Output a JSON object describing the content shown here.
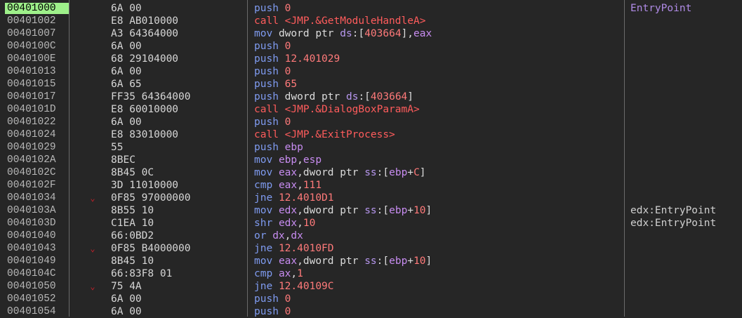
{
  "colors": {
    "background": "#262626",
    "current_address_bg": "#9ef08a",
    "mnemonic": "#7f9bf0",
    "call": "#ff5c5c",
    "number": "#ff7a7a",
    "register": "#c78cf0",
    "label_comment": "#b08be6",
    "jump_arrow": "#c8202a"
  },
  "rows": [
    {
      "addr": "00401000",
      "current": true,
      "arrow": "",
      "bytes": "6A 00",
      "instr": [
        [
          "mn",
          "push"
        ],
        [
          "pn",
          " "
        ],
        [
          "num",
          "0"
        ]
      ],
      "comment": "EntryPoint",
      "comment_type": "label"
    },
    {
      "addr": "00401002",
      "arrow": "",
      "bytes": "E8 AB010000",
      "instr": [
        [
          "call",
          "call"
        ],
        [
          "pn",
          " "
        ],
        [
          "sym",
          "<JMP.&GetModuleHandleA>"
        ]
      ],
      "comment": ""
    },
    {
      "addr": "00401007",
      "arrow": "",
      "bytes": "A3 64364000",
      "instr": [
        [
          "mn",
          "mov"
        ],
        [
          "pn",
          " "
        ],
        [
          "kw",
          "dword ptr"
        ],
        [
          "pn",
          " "
        ],
        [
          "seg",
          "ds"
        ],
        [
          "pn",
          ":["
        ],
        [
          "num",
          "403664"
        ],
        [
          "pn",
          "],"
        ],
        [
          "reg",
          "eax"
        ]
      ],
      "comment": ""
    },
    {
      "addr": "0040100C",
      "arrow": "",
      "bytes": "6A 00",
      "instr": [
        [
          "mn",
          "push"
        ],
        [
          "pn",
          " "
        ],
        [
          "num",
          "0"
        ]
      ],
      "comment": ""
    },
    {
      "addr": "0040100E",
      "arrow": "",
      "bytes": "68 29104000",
      "instr": [
        [
          "mn",
          "push"
        ],
        [
          "pn",
          " "
        ],
        [
          "num",
          "12.401029"
        ]
      ],
      "comment": ""
    },
    {
      "addr": "00401013",
      "arrow": "",
      "bytes": "6A 00",
      "instr": [
        [
          "mn",
          "push"
        ],
        [
          "pn",
          " "
        ],
        [
          "num",
          "0"
        ]
      ],
      "comment": ""
    },
    {
      "addr": "00401015",
      "arrow": "",
      "bytes": "6A 65",
      "instr": [
        [
          "mn",
          "push"
        ],
        [
          "pn",
          " "
        ],
        [
          "num",
          "65"
        ]
      ],
      "comment": ""
    },
    {
      "addr": "00401017",
      "arrow": "",
      "bytes": "FF35 64364000",
      "instr": [
        [
          "mn",
          "push"
        ],
        [
          "pn",
          " "
        ],
        [
          "kw",
          "dword ptr"
        ],
        [
          "pn",
          " "
        ],
        [
          "seg",
          "ds"
        ],
        [
          "pn",
          ":["
        ],
        [
          "num",
          "403664"
        ],
        [
          "pn",
          "]"
        ]
      ],
      "comment": ""
    },
    {
      "addr": "0040101D",
      "arrow": "",
      "bytes": "E8 60010000",
      "instr": [
        [
          "call",
          "call"
        ],
        [
          "pn",
          " "
        ],
        [
          "sym",
          "<JMP.&DialogBoxParamA>"
        ]
      ],
      "comment": ""
    },
    {
      "addr": "00401022",
      "arrow": "",
      "bytes": "6A 00",
      "instr": [
        [
          "mn",
          "push"
        ],
        [
          "pn",
          " "
        ],
        [
          "num",
          "0"
        ]
      ],
      "comment": ""
    },
    {
      "addr": "00401024",
      "arrow": "",
      "bytes": "E8 83010000",
      "instr": [
        [
          "call",
          "call"
        ],
        [
          "pn",
          " "
        ],
        [
          "sym",
          "<JMP.&ExitProcess>"
        ]
      ],
      "comment": ""
    },
    {
      "addr": "00401029",
      "arrow": "",
      "bytes": "55",
      "instr": [
        [
          "mn",
          "push"
        ],
        [
          "pn",
          " "
        ],
        [
          "reg",
          "ebp"
        ]
      ],
      "comment": ""
    },
    {
      "addr": "0040102A",
      "arrow": "",
      "bytes": "8BEC",
      "instr": [
        [
          "mn",
          "mov"
        ],
        [
          "pn",
          " "
        ],
        [
          "reg",
          "ebp"
        ],
        [
          "pn",
          ","
        ],
        [
          "reg",
          "esp"
        ]
      ],
      "comment": ""
    },
    {
      "addr": "0040102C",
      "arrow": "",
      "bytes": "8B45 0C",
      "instr": [
        [
          "mn",
          "mov"
        ],
        [
          "pn",
          " "
        ],
        [
          "reg",
          "eax"
        ],
        [
          "pn",
          ","
        ],
        [
          "kw",
          "dword ptr"
        ],
        [
          "pn",
          " "
        ],
        [
          "seg",
          "ss"
        ],
        [
          "pn",
          ":["
        ],
        [
          "reg",
          "ebp"
        ],
        [
          "pn",
          "+"
        ],
        [
          "num",
          "C"
        ],
        [
          "pn",
          "]"
        ]
      ],
      "comment": ""
    },
    {
      "addr": "0040102F",
      "arrow": "",
      "bytes": "3D 11010000",
      "instr": [
        [
          "mn",
          "cmp"
        ],
        [
          "pn",
          " "
        ],
        [
          "reg",
          "eax"
        ],
        [
          "pn",
          ","
        ],
        [
          "num",
          "111"
        ]
      ],
      "comment": ""
    },
    {
      "addr": "00401034",
      "arrow": "⌄",
      "bytes": "0F85 97000000",
      "instr": [
        [
          "mn",
          "jne"
        ],
        [
          "pn",
          " "
        ],
        [
          "num",
          "12.4010D1"
        ]
      ],
      "comment": ""
    },
    {
      "addr": "0040103A",
      "arrow": "",
      "bytes": "8B55 10",
      "instr": [
        [
          "mn",
          "mov"
        ],
        [
          "pn",
          " "
        ],
        [
          "reg",
          "edx"
        ],
        [
          "pn",
          ","
        ],
        [
          "kw",
          "dword ptr"
        ],
        [
          "pn",
          " "
        ],
        [
          "seg",
          "ss"
        ],
        [
          "pn",
          ":["
        ],
        [
          "reg",
          "ebp"
        ],
        [
          "pn",
          "+"
        ],
        [
          "num",
          "10"
        ],
        [
          "pn",
          "]"
        ]
      ],
      "comment": "edx:EntryPoint",
      "comment_type": "plain"
    },
    {
      "addr": "0040103D",
      "arrow": "",
      "bytes": "C1EA 10",
      "instr": [
        [
          "mn",
          "shr"
        ],
        [
          "pn",
          " "
        ],
        [
          "reg",
          "edx"
        ],
        [
          "pn",
          ","
        ],
        [
          "num",
          "10"
        ]
      ],
      "comment": "edx:EntryPoint",
      "comment_type": "plain"
    },
    {
      "addr": "00401040",
      "arrow": "",
      "bytes": "66:0BD2",
      "instr": [
        [
          "mn",
          "or"
        ],
        [
          "pn",
          " "
        ],
        [
          "reg",
          "dx"
        ],
        [
          "pn",
          ","
        ],
        [
          "reg",
          "dx"
        ]
      ],
      "comment": ""
    },
    {
      "addr": "00401043",
      "arrow": "⌄",
      "bytes": "0F85 B4000000",
      "instr": [
        [
          "mn",
          "jne"
        ],
        [
          "pn",
          " "
        ],
        [
          "num",
          "12.4010FD"
        ]
      ],
      "comment": ""
    },
    {
      "addr": "00401049",
      "arrow": "",
      "bytes": "8B45 10",
      "instr": [
        [
          "mn",
          "mov"
        ],
        [
          "pn",
          " "
        ],
        [
          "reg",
          "eax"
        ],
        [
          "pn",
          ","
        ],
        [
          "kw",
          "dword ptr"
        ],
        [
          "pn",
          " "
        ],
        [
          "seg",
          "ss"
        ],
        [
          "pn",
          ":["
        ],
        [
          "reg",
          "ebp"
        ],
        [
          "pn",
          "+"
        ],
        [
          "num",
          "10"
        ],
        [
          "pn",
          "]"
        ]
      ],
      "comment": ""
    },
    {
      "addr": "0040104C",
      "arrow": "",
      "bytes": "66:83F8 01",
      "instr": [
        [
          "mn",
          "cmp"
        ],
        [
          "pn",
          " "
        ],
        [
          "reg",
          "ax"
        ],
        [
          "pn",
          ","
        ],
        [
          "num",
          "1"
        ]
      ],
      "comment": ""
    },
    {
      "addr": "00401050",
      "arrow": "⌄",
      "bytes": "75 4A",
      "instr": [
        [
          "mn",
          "jne"
        ],
        [
          "pn",
          " "
        ],
        [
          "num",
          "12.40109C"
        ]
      ],
      "comment": ""
    },
    {
      "addr": "00401052",
      "arrow": "",
      "bytes": "6A 00",
      "instr": [
        [
          "mn",
          "push"
        ],
        [
          "pn",
          " "
        ],
        [
          "num",
          "0"
        ]
      ],
      "comment": ""
    },
    {
      "addr": "00401054",
      "arrow": "",
      "bytes": "6A 00",
      "instr": [
        [
          "mn",
          "push"
        ],
        [
          "pn",
          " "
        ],
        [
          "num",
          "0"
        ]
      ],
      "comment": ""
    }
  ]
}
